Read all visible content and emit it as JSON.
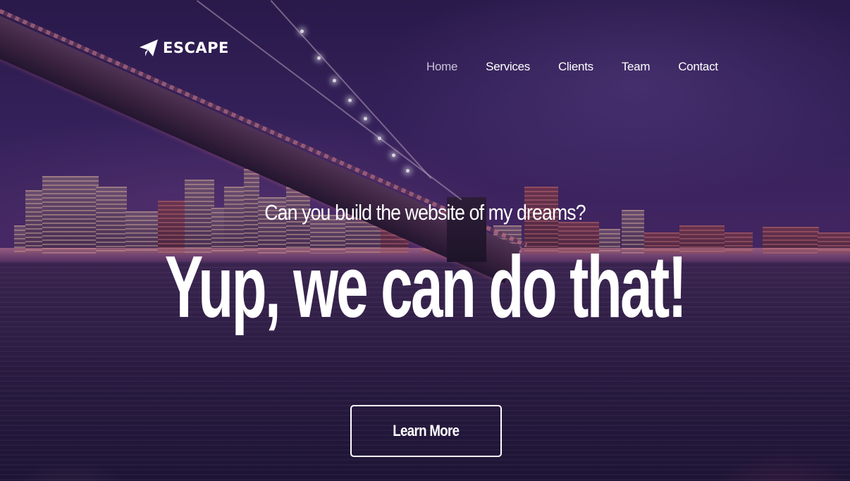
{
  "brand": {
    "name": "ESCAPE",
    "icon": "paper-plane-icon"
  },
  "nav": {
    "items": [
      {
        "label": "Home",
        "active": true
      },
      {
        "label": "Services",
        "active": false
      },
      {
        "label": "Clients",
        "active": false
      },
      {
        "label": "Team",
        "active": false
      },
      {
        "label": "Contact",
        "active": false
      }
    ]
  },
  "hero": {
    "subtitle": "Can you build the website of my dreams?",
    "headline": "Yup, we can do that!",
    "cta_label": "Learn More"
  },
  "colors": {
    "text": "#ffffff",
    "nav_active": "#c8c2d8",
    "sky": "#3b2560",
    "water": "#2a1c3e"
  }
}
